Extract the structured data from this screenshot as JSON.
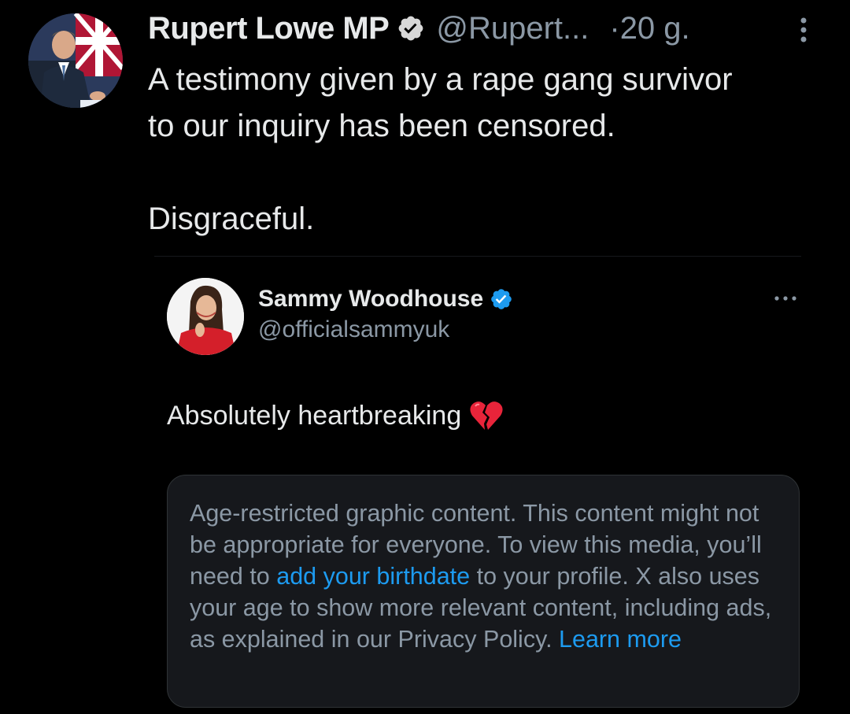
{
  "post": {
    "author": {
      "display_name": "Rupert Lowe MP",
      "handle": "@Rupert...",
      "verified": true,
      "avatar": "rupert-lowe-avatar"
    },
    "time_separator": "·",
    "time": "20 g.",
    "text": "A testimony given by a rape gang survivor\nto our inquiry has been censored.\n\nDisgraceful.",
    "more_icon": "more-vertical-icon"
  },
  "quote": {
    "author": {
      "display_name": "Sammy Woodhouse",
      "handle": "@officialsammyuk",
      "verified": true,
      "avatar": "sammy-woodhouse-avatar"
    },
    "more_icon": "more-horizontal-icon",
    "text": "Absolutely heartbreaking",
    "emoji": "broken-heart-icon"
  },
  "media_notice": {
    "text_before_link": "Age-restricted graphic content. This content might not be appropriate for everyone. To view this media, you’ll need to ",
    "link_birthdate": "add your birthdate",
    "text_after_link": " to your profile. X also uses your age to show more relevant content, including ads, as explained in our Privacy Policy. ",
    "link_learn_more": "Learn more"
  },
  "colors": {
    "background": "#000000",
    "text_primary": "#e7e9ea",
    "text_secondary": "#8b98a5",
    "link": "#1d9bf0",
    "verified": "#1d9bf0",
    "card_background": "#16181c",
    "card_border": "#2f3336"
  }
}
